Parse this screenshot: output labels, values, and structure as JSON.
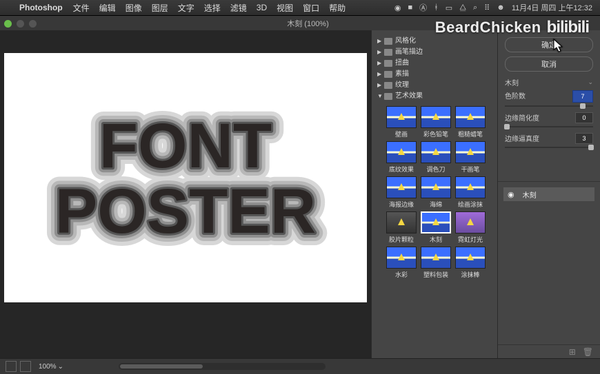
{
  "menubar": {
    "app": "Photoshop",
    "items": [
      "文件",
      "编辑",
      "图像",
      "图层",
      "文字",
      "选择",
      "滤镜",
      "3D",
      "视图",
      "窗口",
      "帮助"
    ],
    "clock": "11月4日 周四 上午12:32"
  },
  "tab": {
    "title": "木刻 (100%)"
  },
  "canvas": {
    "line1": "FONT",
    "line2": "POSTER"
  },
  "filter": {
    "categories": [
      {
        "label": "风格化",
        "open": false
      },
      {
        "label": "画笔描边",
        "open": false
      },
      {
        "label": "扭曲",
        "open": false
      },
      {
        "label": "素描",
        "open": false
      },
      {
        "label": "纹理",
        "open": false
      },
      {
        "label": "艺术效果",
        "open": true
      }
    ],
    "thumbs": [
      {
        "label": "壁画",
        "sel": false,
        "cls": ""
      },
      {
        "label": "彩色铅笔",
        "sel": false,
        "cls": ""
      },
      {
        "label": "粗糙蜡笔",
        "sel": false,
        "cls": ""
      },
      {
        "label": "底纹效果",
        "sel": false,
        "cls": ""
      },
      {
        "label": "调色刀",
        "sel": false,
        "cls": ""
      },
      {
        "label": "干画笔",
        "sel": false,
        "cls": ""
      },
      {
        "label": "海报边缘",
        "sel": false,
        "cls": ""
      },
      {
        "label": "海绵",
        "sel": false,
        "cls": ""
      },
      {
        "label": "绘画涂抹",
        "sel": false,
        "cls": ""
      },
      {
        "label": "胶片颗粒",
        "sel": false,
        "cls": "film"
      },
      {
        "label": "木刻",
        "sel": true,
        "cls": ""
      },
      {
        "label": "霓虹灯光",
        "sel": false,
        "cls": "neon"
      },
      {
        "label": "水彩",
        "sel": false,
        "cls": ""
      },
      {
        "label": "塑料包装",
        "sel": false,
        "cls": ""
      },
      {
        "label": "涂抹棒",
        "sel": false,
        "cls": ""
      }
    ]
  },
  "controls": {
    "ok": "确定",
    "cancel": "取消",
    "preset": "木刻",
    "sliders": [
      {
        "label": "色阶数",
        "value": "7",
        "pos": 88
      },
      {
        "label": "边缘简化度",
        "value": "0",
        "pos": 2
      },
      {
        "label": "边缘逼真度",
        "value": "3",
        "pos": 98
      }
    ]
  },
  "layers": {
    "item": "木刻"
  },
  "status": {
    "zoom": "100%"
  },
  "watermark": {
    "name": "BeardChicken",
    "site": "bilibili"
  }
}
